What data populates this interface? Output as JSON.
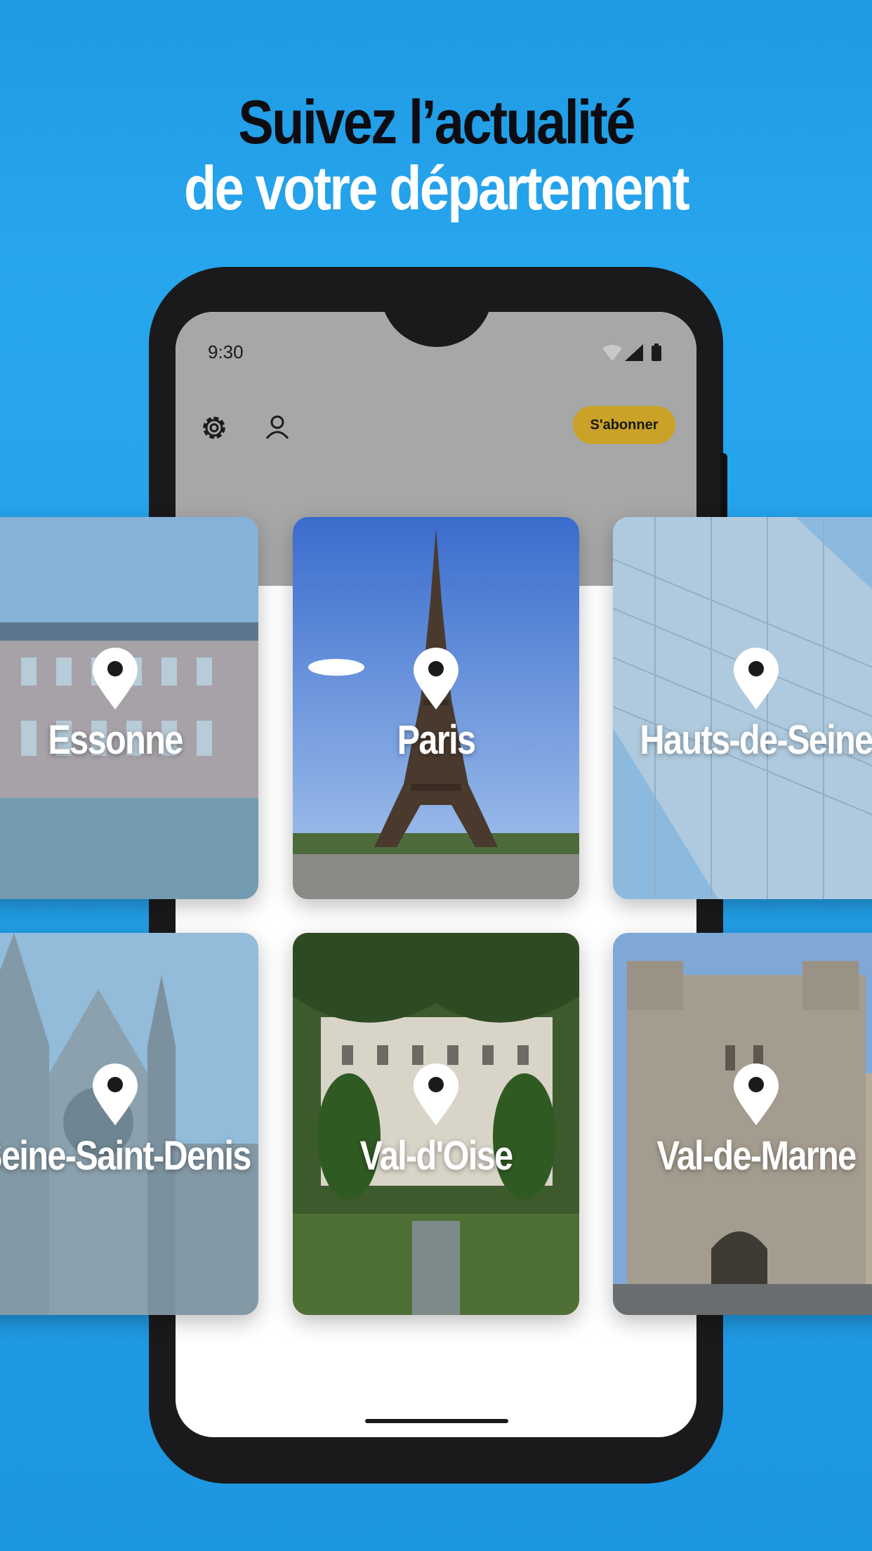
{
  "headline": {
    "line1": "Suivez l’actualité",
    "line2": "de votre département"
  },
  "phone": {
    "status_time": "9:30",
    "subscribe_label": "S'abonner",
    "icons": [
      "settings-gear-icon",
      "account-user-icon",
      "wifi-icon",
      "signal-icon",
      "battery-icon"
    ]
  },
  "departments": [
    {
      "name": "Essonne",
      "faded": true
    },
    {
      "name": "Paris",
      "faded": false
    },
    {
      "name": "Hauts-de-Seine",
      "faded": true
    },
    {
      "name": "Seine-Saint-Denis",
      "faded": true
    },
    {
      "name": "Val-d'Oise",
      "faded": false
    },
    {
      "name": "Val-de-Marne",
      "faded": false
    }
  ],
  "colors": {
    "background": "#1f9ae3",
    "accent_button": "#c9a227",
    "phone_frame": "#1a1a1c"
  }
}
